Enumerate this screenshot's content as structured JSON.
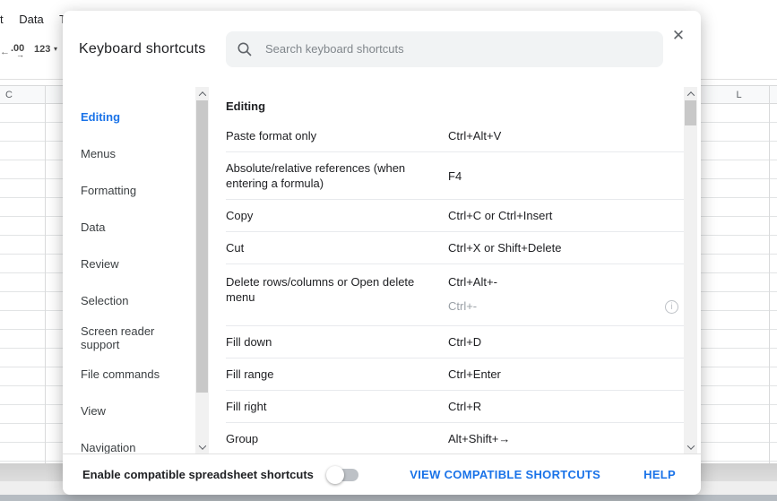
{
  "colors": {
    "accent_blue": "#1a73e8",
    "key_secondary_gray": "#9aa0a6",
    "search_bg": "#f1f3f4"
  },
  "background": {
    "menu_items": [
      "t",
      "Data",
      "To"
    ],
    "toolbar": {
      "left_fragment": "←",
      "decimal": ".00",
      "decimal_arrow": "→",
      "number_format": "123",
      "caret": "▾"
    },
    "column_left": "C",
    "column_right": "L"
  },
  "dialog": {
    "title": "Keyboard shortcuts",
    "search": {
      "placeholder": "Search keyboard shortcuts"
    },
    "close_glyph": "✕",
    "sidebar": {
      "items": [
        {
          "label": "Editing",
          "active": true
        },
        {
          "label": "Menus",
          "active": false
        },
        {
          "label": "Formatting",
          "active": false
        },
        {
          "label": "Data",
          "active": false
        },
        {
          "label": "Review",
          "active": false
        },
        {
          "label": "Selection",
          "active": false
        },
        {
          "label": "Screen reader support",
          "active": false
        },
        {
          "label": "File commands",
          "active": false
        },
        {
          "label": "View",
          "active": false
        },
        {
          "label": "Navigation",
          "active": false
        }
      ]
    },
    "content": {
      "section_title": "Editing",
      "rows": [
        {
          "name": "Paste format only",
          "keys": "Ctrl+Alt+V"
        },
        {
          "name": "Absolute/relative references (when entering a formula)",
          "keys": "F4"
        },
        {
          "name": "Copy",
          "keys": "Ctrl+C or Ctrl+Insert"
        },
        {
          "name": "Cut",
          "keys": "Ctrl+X or Shift+Delete"
        },
        {
          "name": "Delete rows/columns or Open delete menu",
          "keys": "Ctrl+Alt+-",
          "keys_secondary": "Ctrl+-",
          "has_info": true
        },
        {
          "name": "Fill down",
          "keys": "Ctrl+D"
        },
        {
          "name": "Fill range",
          "keys": "Ctrl+Enter"
        },
        {
          "name": "Fill right",
          "keys": "Ctrl+R"
        },
        {
          "name": "Group",
          "keys": "Alt+Shift+→"
        }
      ],
      "info_glyph": "i"
    },
    "footer": {
      "toggle_label": "Enable compatible spreadsheet shortcuts",
      "toggle_state": "off",
      "view_link": "VIEW COMPATIBLE SHORTCUTS",
      "help_link": "HELP"
    }
  }
}
